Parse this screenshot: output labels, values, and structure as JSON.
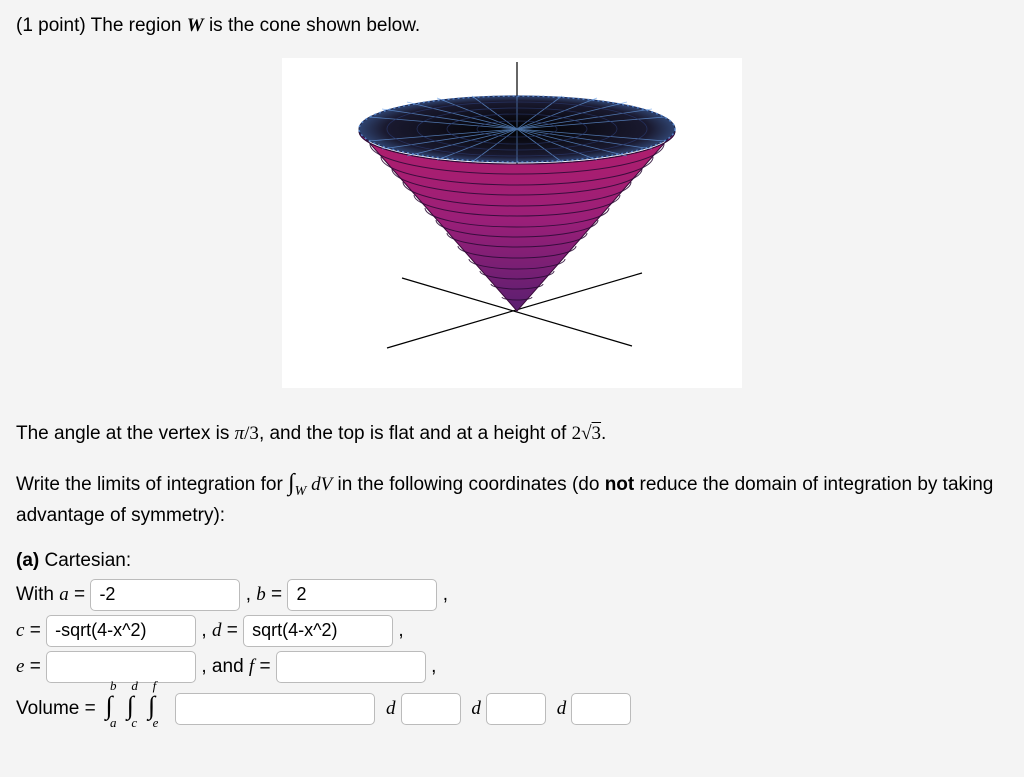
{
  "problem": {
    "points_prefix": "(1 point) ",
    "intro_1": "The region ",
    "region_var": "W",
    "intro_2": " is the cone shown below."
  },
  "desc": {
    "line1_a": "The angle at the vertex is ",
    "vertex_angle": "π",
    "vertex_angle_suffix": "/3",
    "line1_b": ", and the top is flat and at a height of ",
    "height_coef": "2",
    "height_root": "3",
    "line1_c": "."
  },
  "instr": {
    "a": "Write the limits of integration for ",
    "int_sub": "W",
    "dV": " dV",
    "b": " in the following coordinates (do ",
    "not": "not",
    "c": " reduce the domain of integration by taking advantage of symmetry):"
  },
  "partA": {
    "label": "(a)",
    "label_text": " Cartesian:",
    "with": "With ",
    "a": "a",
    "b": "b",
    "c": "c",
    "d": "d",
    "e": "e",
    "f": "f",
    "eq": " =",
    "comma": " , ",
    "and": " , and ",
    "trail_comma": " ,",
    "volume": "Volume = ",
    "d_sym": "d",
    "int_a": "a",
    "int_b": "b",
    "int_c": "c",
    "int_d": "d",
    "int_e": "e",
    "int_f": "f"
  },
  "values": {
    "a": "-2",
    "b": "2",
    "c": "-sqrt(4-x^2)",
    "d": "sqrt(4-x^2)",
    "e": "",
    "f": "",
    "integrand": "",
    "dz": "",
    "dy": "",
    "dx": ""
  }
}
